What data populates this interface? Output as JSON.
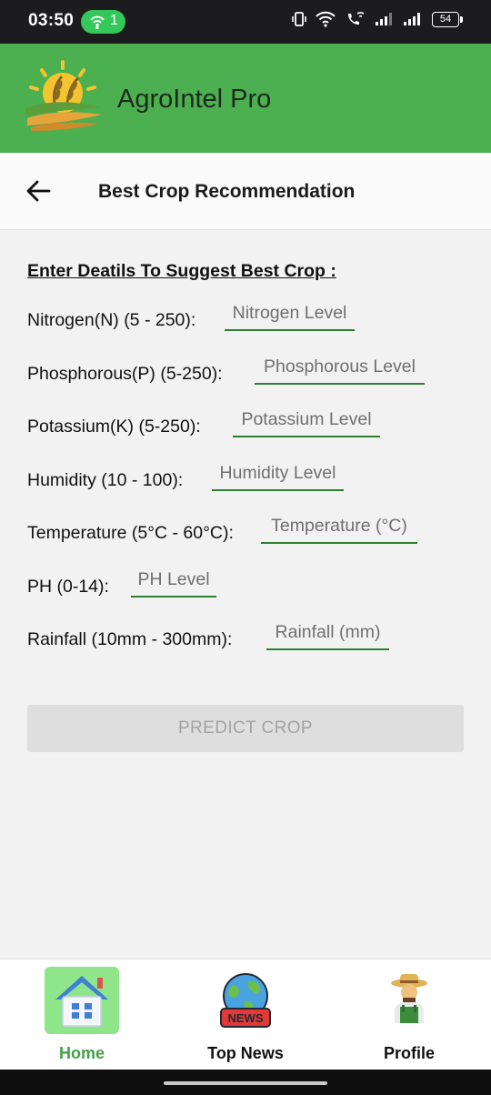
{
  "status_bar": {
    "time": "03:50",
    "hotspot_count": "1",
    "battery": "54"
  },
  "app": {
    "title": "AgroIntel Pro"
  },
  "toolbar": {
    "title": "Best Crop Recommendation",
    "back_icon": "arrow-left-icon"
  },
  "form": {
    "heading": "Enter Deatils To Suggest Best Crop :",
    "fields": [
      {
        "label": "Nitrogen(N) (5 - 250):",
        "placeholder": "Nitrogen Level",
        "value": ""
      },
      {
        "label": "Phosphorous(P) (5-250):",
        "placeholder": "Phosphorous Level",
        "value": ""
      },
      {
        "label": "Potassium(K) (5-250):",
        "placeholder": "Potassium Level",
        "value": ""
      },
      {
        "label": "Humidity (10 - 100):",
        "placeholder": "Humidity Level",
        "value": ""
      },
      {
        "label": "Temperature (5°C - 60°C):",
        "placeholder": "Temperature (°C)",
        "value": ""
      },
      {
        "label": "PH (0-14):",
        "placeholder": "PH Level",
        "value": ""
      },
      {
        "label": "Rainfall (10mm - 300mm):",
        "placeholder": "Rainfall (mm)",
        "value": ""
      }
    ],
    "submit_label": "PREDICT CROP"
  },
  "bottom_nav": {
    "items": [
      {
        "label": "Home",
        "icon": "home-icon",
        "active": true
      },
      {
        "label": "Top News",
        "icon": "news-globe-icon",
        "active": false,
        "badge_text": "NEWS"
      },
      {
        "label": "Profile",
        "icon": "farmer-avatar-icon",
        "active": false
      }
    ]
  },
  "colors": {
    "app_bar": "#4caf50",
    "accent_underline": "#2e7d32",
    "active_nav_bg": "#8ee58a",
    "active_nav_text": "#43a047",
    "disabled_button": "#dedede"
  }
}
